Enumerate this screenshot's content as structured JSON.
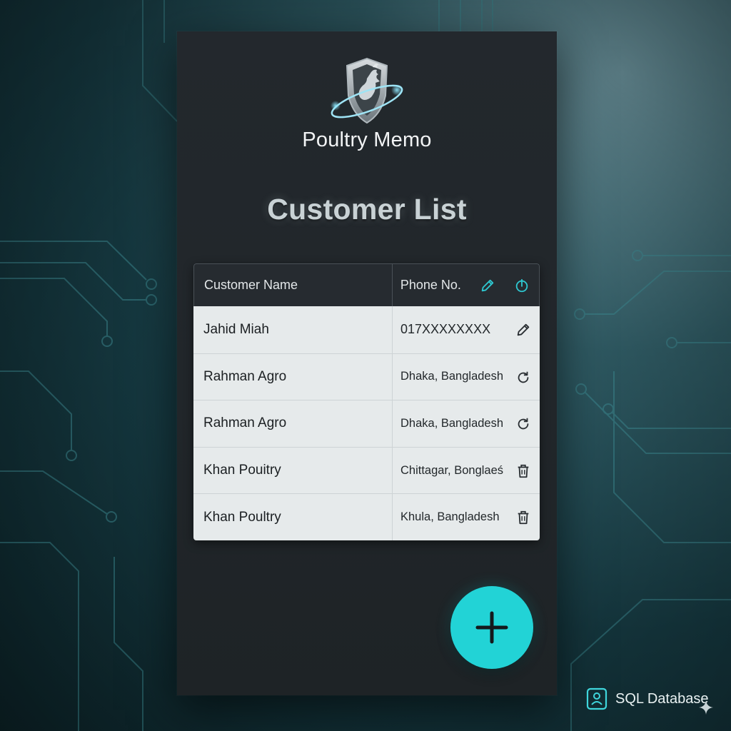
{
  "app": {
    "name": "Poultry Memo",
    "page_title": "Customer List"
  },
  "table": {
    "headers": {
      "name": "Customer Name",
      "phone": "Phone No."
    },
    "header_icons": [
      "edit-icon",
      "power-icon"
    ],
    "rows": [
      {
        "name": "Jahid Miah",
        "phone": "017XXXXXXXX",
        "icon": "edit-icon"
      },
      {
        "name": "Rahman Agro",
        "phone": "Dhaka, Bangladesh",
        "icon": "refresh-icon"
      },
      {
        "name": "Rahman Agro",
        "phone": "Dhaka, Bangladesh",
        "icon": "refresh-icon"
      },
      {
        "name": "Khan Pouitry",
        "phone": "Chittagar, Bonglaeś",
        "icon": "trash-icon"
      },
      {
        "name": "Khan Poultry",
        "phone": "Khula, Bangladesh",
        "icon": "trash-icon"
      }
    ]
  },
  "fab": {
    "icon": "plus-icon"
  },
  "footer": {
    "label": "SQL Database",
    "icon": "database-icon"
  },
  "colors": {
    "accent": "#22d3d6",
    "panel": "#23282d",
    "table_body": "#e6eaeb",
    "header_icon": "#2ec7d0"
  }
}
